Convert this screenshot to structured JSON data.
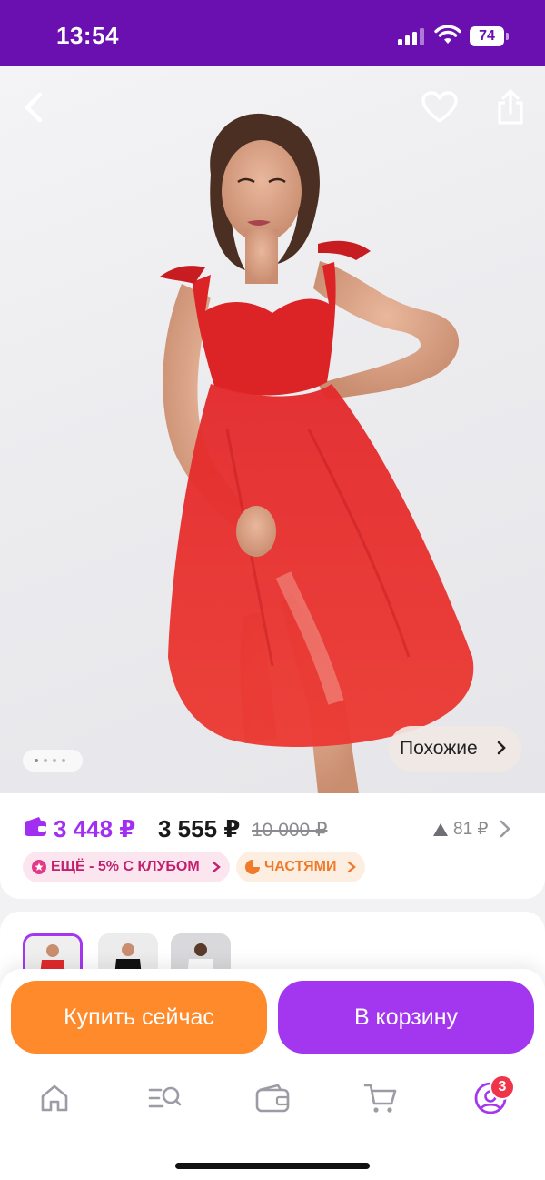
{
  "status_bar": {
    "time": "13:54",
    "battery": "74"
  },
  "gallery": {
    "similar_label": "Похожие",
    "dots_total": 4,
    "dots_active": 1
  },
  "price": {
    "club_price": "3 448 ₽",
    "current_price": "3 555 ₽",
    "old_price": "10 000 ₽",
    "rating_count": "81 ₽"
  },
  "promos": {
    "club": "ЕЩЁ - 5% С КЛУБОМ",
    "installments": "ЧАСТЯМИ"
  },
  "actions": {
    "buy_now": "Купить сейчас",
    "add_to_cart": "В корзину"
  },
  "tabbar": {
    "profile_badge": "3"
  },
  "colors": {
    "brand": "#6a0fb0",
    "accent_purple": "#a337f0",
    "accent_orange": "#ff8a2b",
    "club_pink": "#c2206e",
    "dress_red": "#e3262b"
  },
  "icons": [
    "back-icon",
    "heart-icon",
    "share-icon",
    "wallet-icon",
    "rating-triangle-icon",
    "chevron-right-icon",
    "club-star-icon",
    "installments-icon",
    "home-icon",
    "catalog-search-icon",
    "wallet-tab-icon",
    "cart-icon",
    "profile-icon"
  ]
}
